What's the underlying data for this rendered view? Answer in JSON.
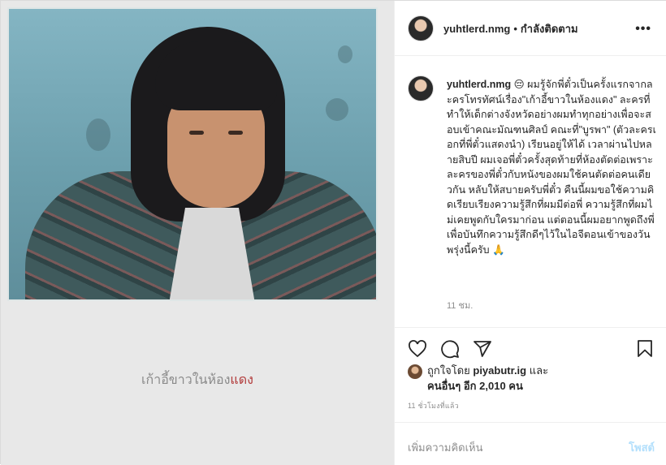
{
  "header": {
    "username": "yuhtlerd.nmg",
    "separator": "•",
    "follow_status": "กำลังติดตาม",
    "more_label": "•••"
  },
  "media": {
    "caption_prefix": "เก้าอี้ขาวในห้อง",
    "caption_highlight": "แดง"
  },
  "post": {
    "username": "yuhtlerd.nmg",
    "caption": "😔 ผมรู้จักพี่ตั๋วเป็นครั้งแรกจากละครโทรทัศน์เรื่อง\"เก้าอี้ขาวในห้องแดง\" ละครที่ทำให้เด็กต่างจังหวัดอย่างผมทำทุกอย่างเพื่อจะสอบเข้าคณะมัณฑนศิลป์ คณะที่\"บูรพา\" (ตัวละครเอกที่พี่ตั๋วแสดงนำ) เรียนอยู่ให้ได้ เวลาผ่านไปหลายสิบปี ผมเจอพี่ตั๋วครั้งสุดท้ายที่ห้องตัดต่อเพราะละครของพี่ตั๋วกับหนังของผมใช้คนตัดต่อคนเดียวกัน หลับให้สบายครับพี่ตั๋ว คืนนี้ผมขอใช้ความคิดเรียบเรียงความรู้สึกที่ผมมีต่อพี่ ความรู้สึกที่ผมไม่เคยพูดกับใครมาก่อน แต่ตอนนี้ผมอยากพูดถึงพี่ เพื่อบันทึกความรู้สึกดีๆไว้ในไอจีตอนเข้าของวันพรุ่งนี้ครับ 🙏",
    "time": "11 ชม."
  },
  "actions": {
    "like_icon": "heart-icon",
    "comment_icon": "comment-icon",
    "share_icon": "paper-plane-icon",
    "save_icon": "bookmark-icon"
  },
  "likes": {
    "prefix": "ถูกใจโดย",
    "user": "piyabutr.ig",
    "conj": "และ",
    "others": "คนอื่นๆ อีก 2,010 คน"
  },
  "timestamp": "11 ชั่วโมงที่แล้ว",
  "add_comment": {
    "placeholder": "เพิ่มความคิดเห็น",
    "post_label": "โพสต์"
  },
  "colors": {
    "post_button": "#b2dffc",
    "caption_highlight": "#b23a3a"
  }
}
